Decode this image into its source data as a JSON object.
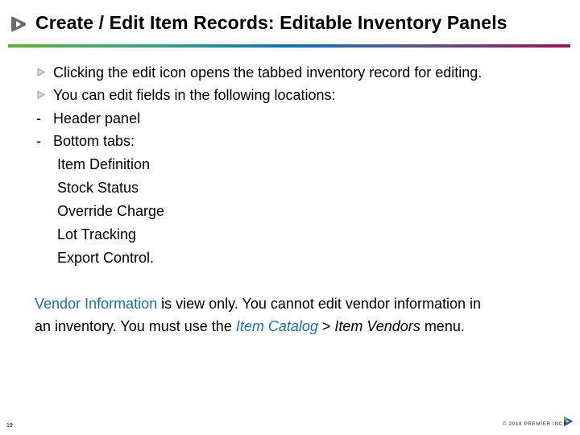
{
  "slide": {
    "title": "Create / Edit Item Records: Editable Inventory Panels",
    "bullets": [
      {
        "type": "arrow",
        "text": "Clicking the edit icon opens the tabbed inventory record for editing."
      },
      {
        "type": "arrow",
        "text": "You can edit fields in the following locations:"
      },
      {
        "type": "dash",
        "marker": "-",
        "text": "Header panel"
      },
      {
        "type": "dash",
        "marker": "-",
        "text": "Bottom tabs:"
      }
    ],
    "tabs": [
      "Item Definition",
      "Stock Status",
      "Override Charge",
      "Lot Tracking",
      "Export Control."
    ],
    "note": {
      "line1_highlight": "Vendor Information",
      "line1_rest": " is view only. You cannot edit vendor information in",
      "line2_start": "an inventory. You must use the ",
      "line2_link1": "Item Catalog",
      "line2_sep": " > ",
      "line2_link2": "Item Vendors",
      "line2_end": " menu."
    },
    "page_number": "19",
    "copyright": "© 2018 PREMIER INC",
    "colors": {
      "accent_blue": "#1f6fa0",
      "rule_start": "#6aab46",
      "rule_mid": "#1b6fa6",
      "rule_end": "#8a1a5a"
    }
  }
}
